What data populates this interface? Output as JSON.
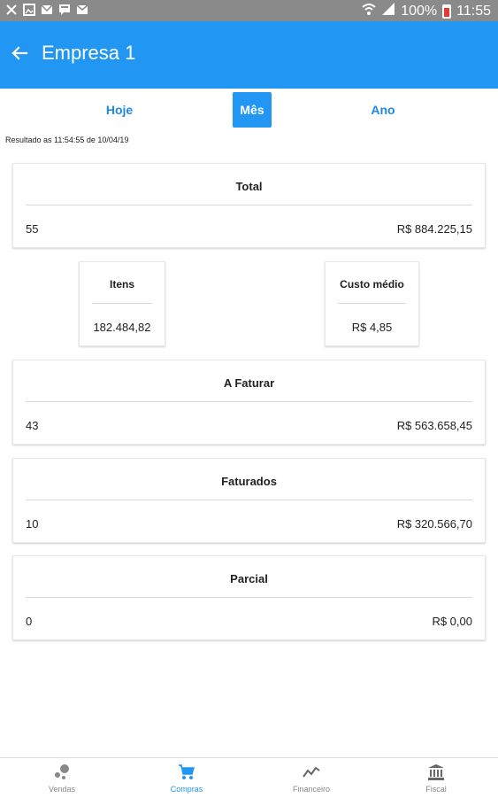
{
  "status_bar": {
    "battery": "100%",
    "time": "11:55",
    "icons": [
      "usb-icon",
      "image-icon",
      "message-icon",
      "chat-icon",
      "mail-icon",
      "wifi-icon",
      "signal-icon",
      "battery-icon"
    ]
  },
  "app_bar": {
    "title": "Empresa 1",
    "back_icon": "arrow-left-icon"
  },
  "tabs": [
    {
      "label": "Hoje",
      "active": false
    },
    {
      "label": "Mês",
      "active": true
    },
    {
      "label": "Ano",
      "active": false
    }
  ],
  "result_note": "Resultado as 11:54:55 de 10/04/19",
  "cards": {
    "total": {
      "title": "Total",
      "count": "55",
      "amount": "R$ 884.225,15"
    },
    "a_faturar": {
      "title": "A Faturar",
      "count": "43",
      "amount": "R$ 563.658,45"
    },
    "faturados": {
      "title": "Faturados",
      "count": "10",
      "amount": "R$ 320.566,70"
    },
    "parcial": {
      "title": "Parcial",
      "count": "0",
      "amount": "R$ 0,00"
    }
  },
  "mini_cards": {
    "itens": {
      "title": "Itens",
      "value": "182.484,82"
    },
    "custo_medio": {
      "title": "Custo médio",
      "value": "R$ 4,85"
    }
  },
  "bottom_nav": [
    {
      "label": "Vendas",
      "icon": "sales-icon",
      "active": false
    },
    {
      "label": "Compras",
      "icon": "cart-icon",
      "active": true
    },
    {
      "label": "Financeiro",
      "icon": "trend-icon",
      "active": false
    },
    {
      "label": "Fiscal",
      "icon": "bank-icon",
      "active": false
    }
  ],
  "colors": {
    "primary": "#2196f3",
    "status_bar": "#8a8a8a",
    "inactive_nav": "#888888"
  }
}
